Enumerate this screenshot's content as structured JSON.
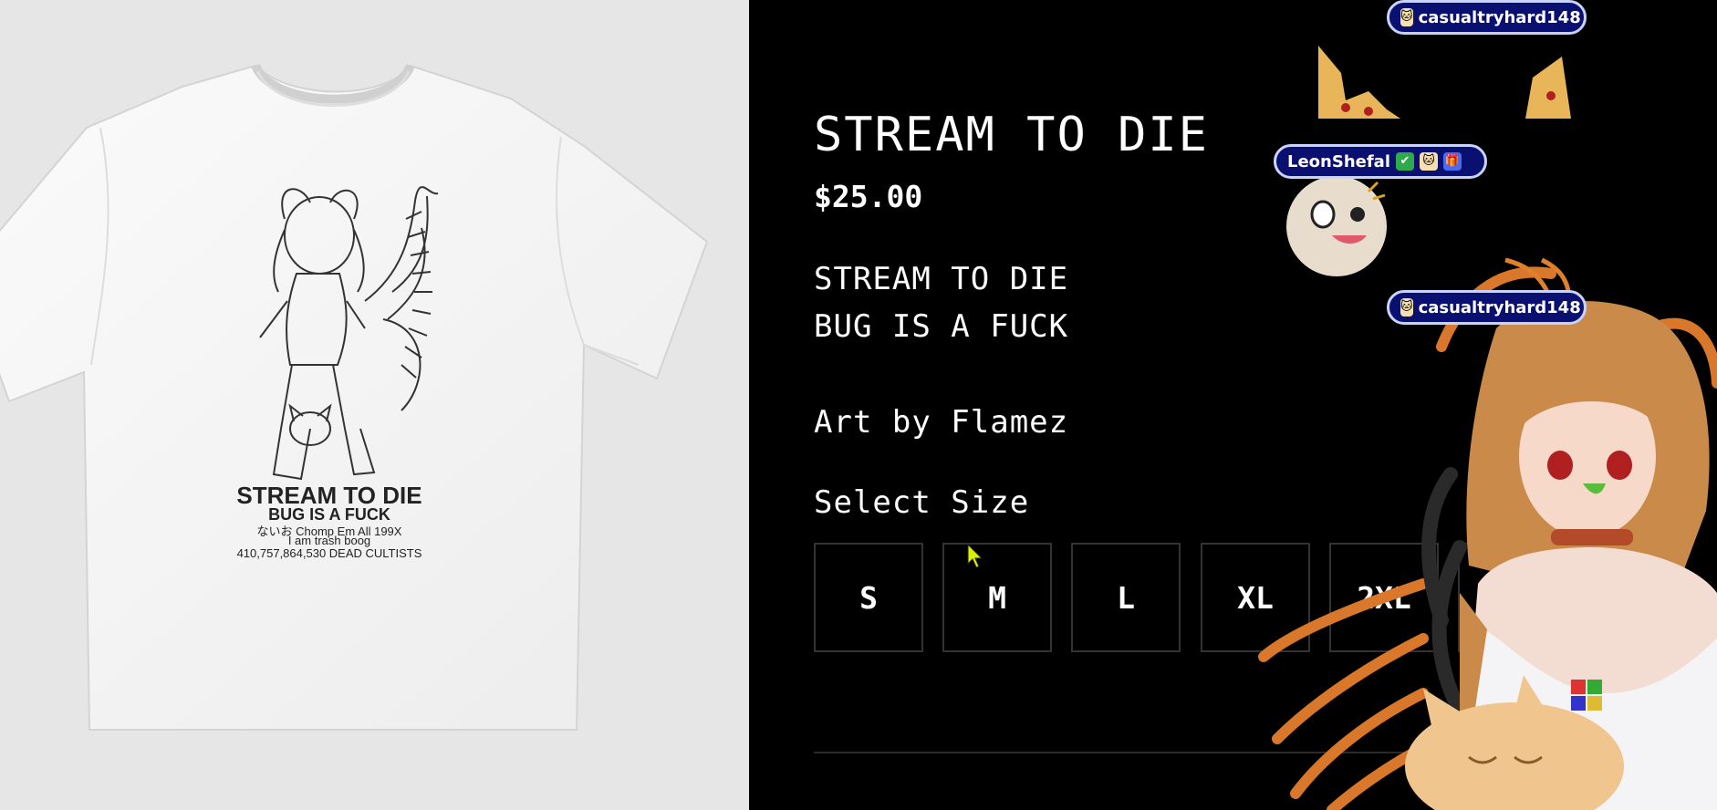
{
  "product": {
    "title": "STREAM TO DIE",
    "price": "$25.00",
    "description_line1": "STREAM TO DIE",
    "description_line2": "BUG IS A FUCK",
    "credit": "Art by Flamez",
    "select_size_label": "Select Size",
    "sizes": [
      "S",
      "M",
      "L",
      "XL",
      "2XL"
    ]
  },
  "shirt_print": {
    "line1": "STREAM TO DIE",
    "line2": "BUG IS A FUCK",
    "line3": "ないお Chomp Em All 199X",
    "line4": "I am trash boog",
    "line5": "410,757,864,530 DEAD CULTISTS"
  },
  "stream_overlay": {
    "chat": [
      {
        "user": "casualtryhard148"
      },
      {
        "user": "LeonShefal"
      },
      {
        "user": "casualtryhard148"
      }
    ]
  },
  "colors": {
    "page_bg": "#000000",
    "image_bg": "#e6e6e6",
    "badge_bg": "#0a1070",
    "badge_border": "#c8d4ff",
    "vtuber_hair": "#c98a4a",
    "centipede_orange": "#e0802a"
  }
}
